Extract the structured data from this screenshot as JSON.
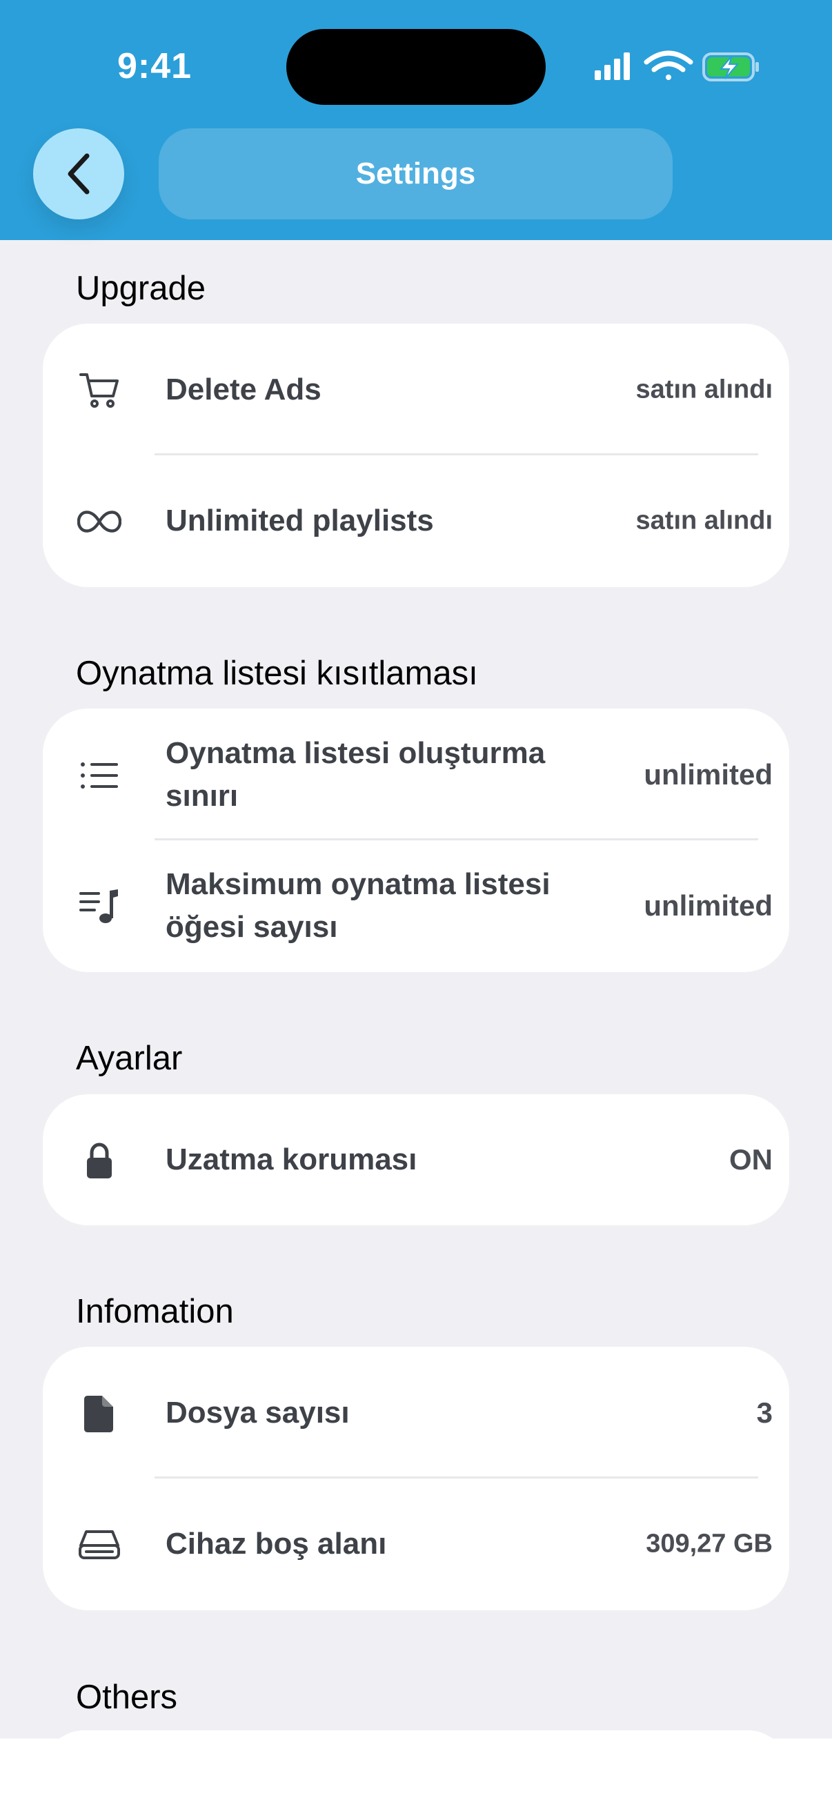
{
  "status_bar": {
    "time": "9:41"
  },
  "header": {
    "title": "Settings",
    "back_icon": "chevron-left-icon"
  },
  "sections": {
    "upgrade": {
      "title": "Upgrade",
      "rows": [
        {
          "icon": "cart-icon",
          "label": "Delete Ads",
          "value": "satın alındı"
        },
        {
          "icon": "infinity-icon",
          "label": "Unlimited playlists",
          "value": "satın alındı"
        }
      ]
    },
    "playlist_limits": {
      "title": "Oynatma listesi kısıtlaması",
      "rows": [
        {
          "icon": "list-icon",
          "label": "Oynatma listesi oluşturma sınırı",
          "value": "unlimited"
        },
        {
          "icon": "music-list-icon",
          "label": "Maksimum oynatma listesi öğesi sayısı",
          "value": "unlimited"
        }
      ]
    },
    "settings": {
      "title": "Ayarlar",
      "rows": [
        {
          "icon": "lock-icon",
          "label": "Uzatma koruması",
          "value": "ON"
        }
      ]
    },
    "information": {
      "title": "Infomation",
      "rows": [
        {
          "icon": "file-icon",
          "label": "Dosya sayısı",
          "value": "3"
        },
        {
          "icon": "drive-icon",
          "label": "Cihaz boş alanı",
          "value": "309,27 GB"
        }
      ]
    },
    "others": {
      "title": "Others"
    }
  },
  "colors": {
    "header_bg": "#2b9fd9",
    "page_bg": "#f0f0f4",
    "back_button_bg": "#a9e3fb",
    "label_text": "#3e4248",
    "battery_green": "#34c759"
  }
}
